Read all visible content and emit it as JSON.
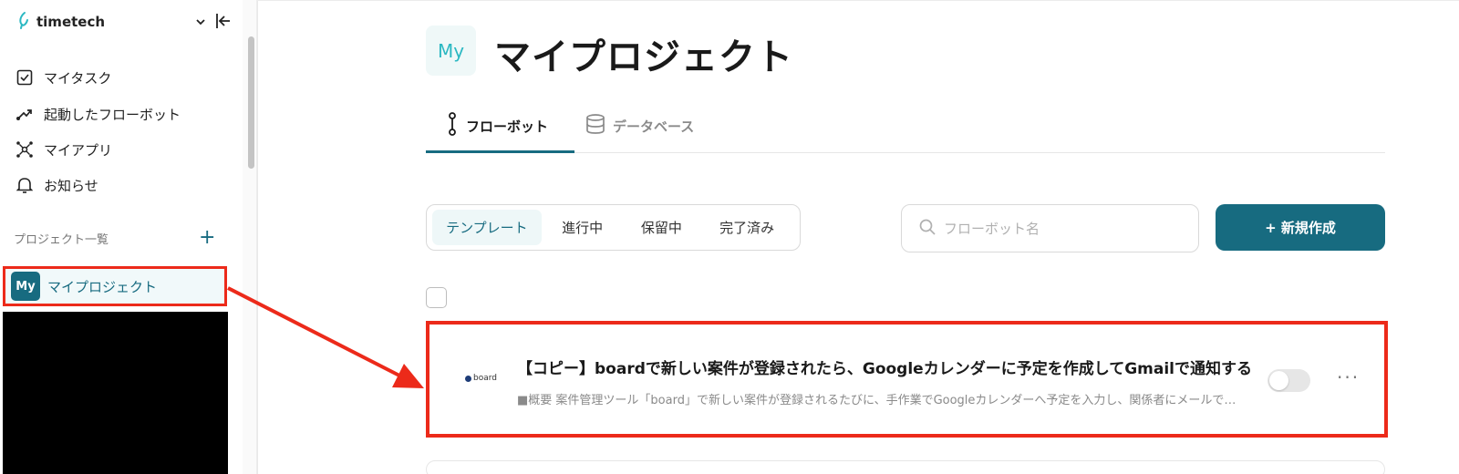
{
  "sidebar": {
    "brand": "timetech",
    "nav": [
      {
        "label": "マイタスク",
        "icon": "checkbox-icon"
      },
      {
        "label": "起動したフローボット",
        "icon": "flow-trend-icon"
      },
      {
        "label": "マイアプリ",
        "icon": "apps-network-icon"
      },
      {
        "label": "お知らせ",
        "icon": "bell-icon"
      }
    ],
    "projects_heading": "プロジェクト一覧",
    "project_add_label": "+",
    "project": {
      "badge": "My",
      "label": "マイプロジェクト"
    }
  },
  "main": {
    "badge": "My",
    "title": "マイプロジェクト",
    "tabs": [
      {
        "label": "フローボット",
        "active": true
      },
      {
        "label": "データベース",
        "active": false
      }
    ],
    "filters": [
      {
        "label": "テンプレート",
        "active": true
      },
      {
        "label": "進行中",
        "active": false
      },
      {
        "label": "保留中",
        "active": false
      },
      {
        "label": "完了済み",
        "active": false
      }
    ],
    "search": {
      "placeholder": "フローボット名"
    },
    "new_button": "+ 新規作成",
    "flow": {
      "logo_text": "board",
      "title": "【コピー】boardで新しい案件が登録されたら、Googleカレンダーに予定を作成してGmailで通知する",
      "description": "■概要 案件管理ツール「board」で新しい案件が登録されるたびに、手作業でGoogleカレンダーへ予定を入力し、関係者にメールで…",
      "enabled": false,
      "more_label": "···"
    }
  },
  "colors": {
    "accent": "#176b80",
    "highlight": "#ec2a1a",
    "badge_text": "#2bb8c2"
  }
}
